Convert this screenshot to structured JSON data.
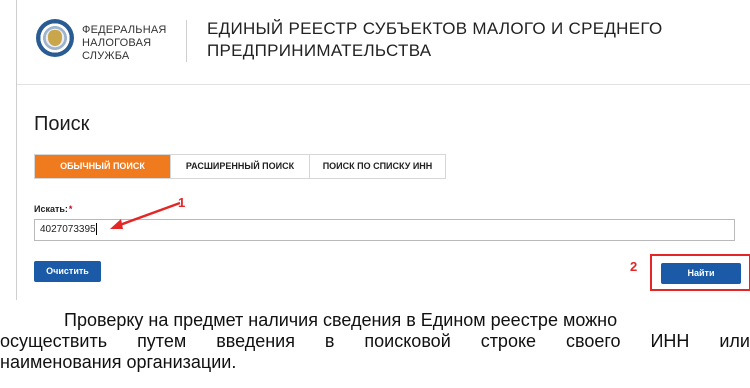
{
  "header": {
    "org_name_line1": "ФЕДЕРАЛЬНАЯ",
    "org_name_line2": "НАЛОГОВАЯ СЛУЖБА",
    "registry_title_line1": "ЕДИНЫЙ РЕЕСТР СУБЪЕКТОВ МАЛОГО И СРЕДНЕГО",
    "registry_title_line2": "ПРЕДПРИНИМАТЕЛЬСТВА",
    "logo_icon": "fns-emblem-icon"
  },
  "page_title": "Поиск",
  "tabs": [
    {
      "label": "ОБЫЧНЫЙ ПОИСК",
      "active": true
    },
    {
      "label": "РАСШИРЕННЫЙ ПОИСК",
      "active": false
    },
    {
      "label": "ПОИСК ПО СПИСКУ ИНН",
      "active": false
    }
  ],
  "search": {
    "label": "Искать:",
    "required_mark": "*",
    "value": "4027073395"
  },
  "buttons": {
    "clear_label": "Очистить",
    "find_label": "Найти"
  },
  "annotations": {
    "marker_1": "1",
    "marker_2": "2",
    "accent_color": "#e32626"
  },
  "colors": {
    "active_tab": "#f07a1e",
    "button": "#1a5aa6"
  },
  "caption": {
    "line1": "Проверку на предмет наличия сведения в Едином реестре можно",
    "line2_words": [
      "осуществить",
      "путем",
      "введения",
      "в",
      "поисковой",
      "строке",
      "своего",
      "ИНН",
      "или"
    ],
    "line3": "наименования организации."
  }
}
